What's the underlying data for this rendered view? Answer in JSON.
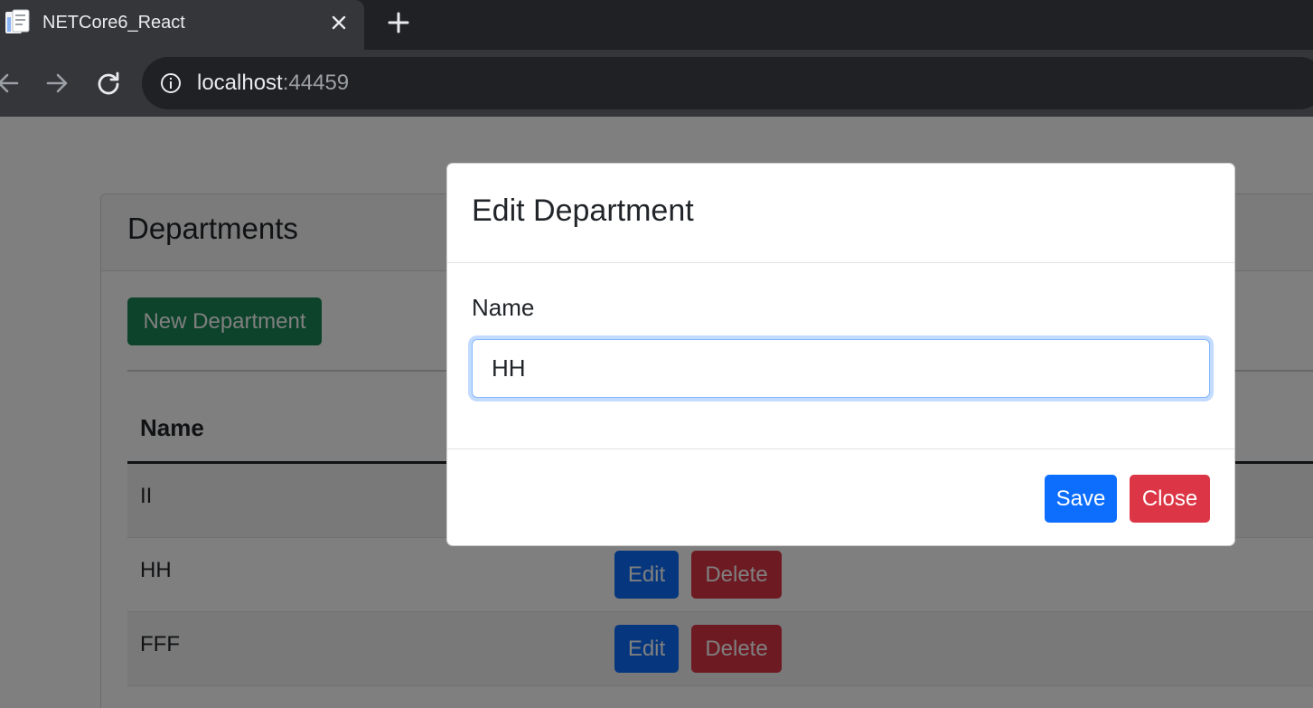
{
  "browser": {
    "tab_title": "NETCore6_React",
    "url_host": "localhost",
    "url_port": ":44459",
    "icons": {
      "favicon": "document-icon",
      "tab_close": "close-icon",
      "new_tab": "plus-icon",
      "back": "arrow-left-icon",
      "forward": "arrow-right-icon",
      "reload": "reload-icon",
      "site_info": "info-icon"
    }
  },
  "page": {
    "card_title": "Departments",
    "new_button_label": "New Department",
    "table": {
      "headers": [
        "Name"
      ],
      "rows": [
        {
          "name": "II"
        },
        {
          "name": "HH",
          "edit_label": "Edit",
          "delete_label": "Delete"
        },
        {
          "name": "FFF",
          "edit_label": "Edit",
          "delete_label": "Delete"
        }
      ]
    }
  },
  "modal": {
    "title": "Edit Department",
    "name_label": "Name",
    "name_value": "HH",
    "save_label": "Save",
    "close_label": "Close"
  },
  "colors": {
    "primary": "#0d6efd",
    "danger": "#dc3545",
    "success": "#198754",
    "chrome_dark": "#202124",
    "chrome_tab": "#35363a"
  }
}
